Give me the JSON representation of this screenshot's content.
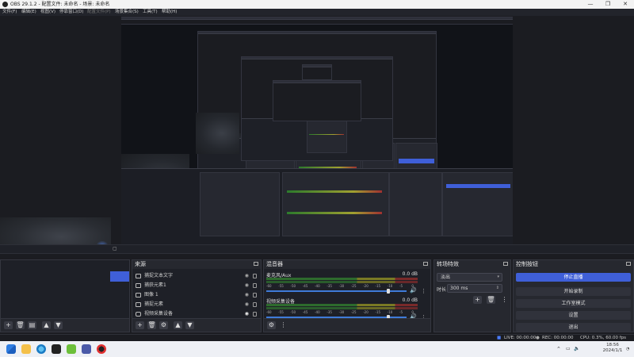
{
  "window": {
    "title": "OBS 29.1.2 - 配置文件: 未命名 - 场景: 未命名",
    "controls": [
      "—",
      "❐",
      "✕"
    ]
  },
  "menubar": [
    "文件(F)",
    "编辑(E)",
    "视图(V)",
    "停靠窗口(D)",
    "配置文件(P)",
    "场景集合(S)",
    "工具(T)",
    "帮助(H)"
  ],
  "docks": {
    "sources": {
      "title": "来源",
      "items": [
        {
          "label": "捕捉文本文字",
          "icon": "text-icon"
        },
        {
          "label": "捕获元素1",
          "icon": "image-icon"
        },
        {
          "label": "图像 1",
          "icon": "image-icon"
        },
        {
          "label": "捕捉元素",
          "icon": "image-icon"
        },
        {
          "label": "视频采集设备",
          "icon": "camera-icon"
        }
      ]
    },
    "mixer": {
      "title": "混音器",
      "scale": [
        "-60",
        "-55",
        "-50",
        "-45",
        "-40",
        "-35",
        "-30",
        "-25",
        "-20",
        "-15",
        "-10",
        "-5",
        "0"
      ],
      "channels": [
        {
          "name": "麦克风/Aux",
          "db": "0.0 dB",
          "level": 0.86
        },
        {
          "name": "视频采集设备",
          "db": "0.0 dB",
          "level": 0.86
        }
      ]
    },
    "transitions": {
      "title": "转场特效",
      "selected": "淡出",
      "duration_label": "时长",
      "duration_value": "300 ms"
    },
    "controls": {
      "title": "控制按钮",
      "buttons": [
        "停止直播",
        "开始录制",
        "工作室模式",
        "设置",
        "退出"
      ]
    }
  },
  "statusbar": {
    "live": "LIVE: 00:00:00",
    "rec": "REC: 00:00:00",
    "cpu": "CPU: 0.3%, 60.00 fps"
  },
  "taskbar": {
    "time": "18:56",
    "date": "2024/1/1"
  },
  "colors": {
    "accent": "#3f5fd8",
    "panel": "#26282f",
    "background": "#1b1c21"
  }
}
